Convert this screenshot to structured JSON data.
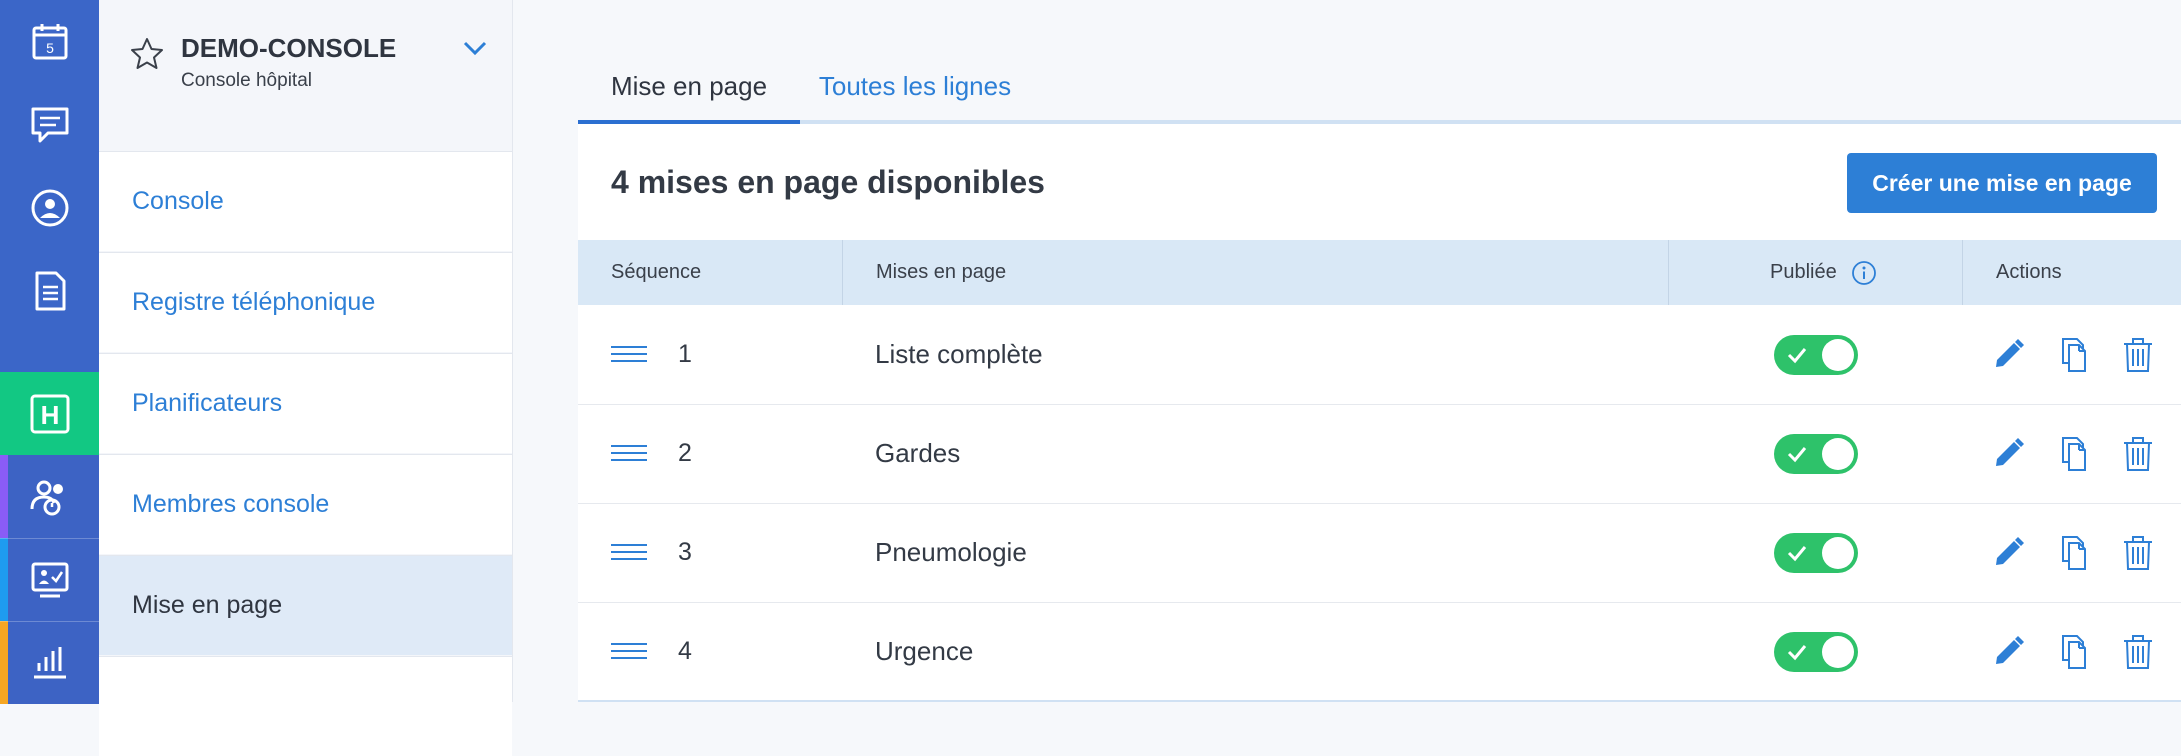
{
  "rail": {
    "items": [
      {
        "icon": "calendar-icon",
        "badge": "5"
      },
      {
        "icon": "chat-icon"
      },
      {
        "icon": "user-circle-icon"
      },
      {
        "icon": "document-icon"
      },
      {
        "icon": "hospital-h-icon",
        "letter": "H"
      },
      {
        "icon": "team-icon"
      },
      {
        "icon": "monitor-check-icon"
      },
      {
        "icon": "bar-chart-icon"
      }
    ],
    "colors": {
      "rail_bg": "#3b66c8",
      "active_h": "#12c883",
      "stripe_purple": "#8a5cf6",
      "stripe_blue": "#1e9bf0",
      "stripe_orange": "#f5a623"
    }
  },
  "sidebar": {
    "console_name": "DEMO-CONSOLE",
    "console_sub": "Console hôpital",
    "items": [
      {
        "label": "Console"
      },
      {
        "label": "Registre téléphonique"
      },
      {
        "label": "Planificateurs"
      },
      {
        "label": "Membres console"
      },
      {
        "label": "Mise en page",
        "active": true
      }
    ]
  },
  "tabs": [
    {
      "label": "Mise en page",
      "active": true
    },
    {
      "label": "Toutes les lignes"
    }
  ],
  "main": {
    "title": "4 mises en page disponibles",
    "create_button": "Créer une mise en page",
    "columns": {
      "sequence": "Séquence",
      "layouts": "Mises en page",
      "published": "Publiée",
      "actions": "Actions"
    },
    "rows": [
      {
        "seq": "1",
        "name": "Liste complète",
        "published": true
      },
      {
        "seq": "2",
        "name": "Gardes",
        "published": true
      },
      {
        "seq": "3",
        "name": "Pneumologie",
        "published": true
      },
      {
        "seq": "4",
        "name": "Urgence",
        "published": true
      }
    ]
  },
  "colors": {
    "accent": "#2d7fd6",
    "toggle_on": "#2ec26a",
    "header_bg": "#d9e8f6"
  }
}
